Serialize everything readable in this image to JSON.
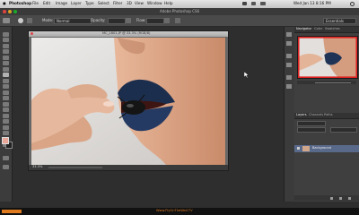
{
  "menubar": {
    "app": "Photoshop",
    "items": [
      "File",
      "Edit",
      "Image",
      "Layer",
      "Type",
      "Select",
      "Filter",
      "3D",
      "View",
      "Window",
      "Help"
    ],
    "clock": "Wed Jan 13  8:16 PM"
  },
  "window_title": "Adobe Photoshop CS6",
  "workspace": "Essentials",
  "options": {
    "mode_label": "Mode:",
    "mode_value": "Normal",
    "opacity_label": "Opacity:",
    "flow_label": "Flow:"
  },
  "document": {
    "tab_title": "MC_1601.JP @ 33.3% (RGB/8)",
    "zoom": "33.3%"
  },
  "panels": {
    "nav_tabs": [
      "Navigator",
      "Color",
      "Swatches"
    ],
    "layer_tabs": [
      "Layers",
      "Channels",
      "Paths"
    ],
    "layer_name": "Background"
  },
  "bottom": {
    "watermark": "Www.FlyOnTheWall.TV"
  },
  "colors": {
    "workspace_bg": "#2e2e2e",
    "foreground_swatch": "#e9a79a",
    "background_swatch": "#222222",
    "accent_orange": "#e07a1f"
  }
}
